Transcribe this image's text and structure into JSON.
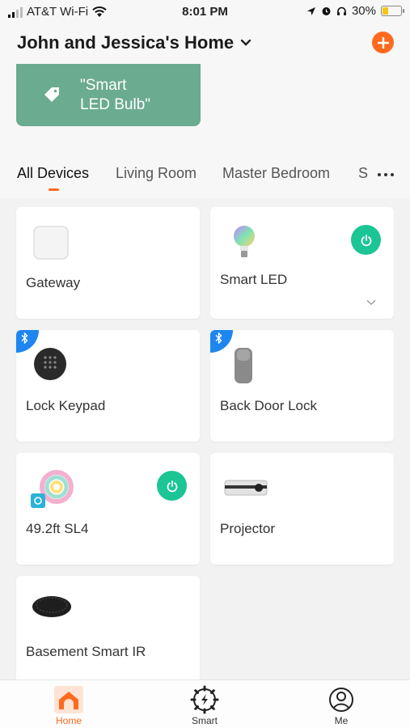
{
  "status": {
    "carrier": "AT&T Wi-Fi",
    "time": "8:01 PM",
    "battery": "30%",
    "battery_level": 0.3
  },
  "header": {
    "home_name": "John and Jessica's Home"
  },
  "scene": {
    "label": "\"Smart\nLED Bulb\""
  },
  "tabs": [
    {
      "label": "All Devices",
      "active": true
    },
    {
      "label": "Living Room"
    },
    {
      "label": "Master Bedroom"
    },
    {
      "label": "S"
    }
  ],
  "devices": [
    {
      "name": "Gateway"
    },
    {
      "name": "Smart LED"
    },
    {
      "name": "Lock Keypad"
    },
    {
      "name": "Back Door Lock"
    },
    {
      "name": "49.2ft SL4"
    },
    {
      "name": "Projector"
    },
    {
      "name": "Basement Smart IR"
    }
  ],
  "nav": {
    "home": "Home",
    "smart": "Smart",
    "me": "Me"
  },
  "colors": {
    "accent": "#ff6a1f",
    "power": "#1cc594",
    "bluetooth": "#1f86f0",
    "scene": "#6bab90"
  }
}
